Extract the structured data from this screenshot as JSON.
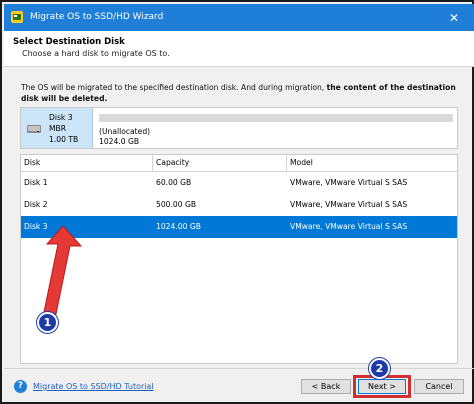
{
  "window": {
    "title": "Migrate OS to SSD/HD Wizard",
    "close_glyph": "✕"
  },
  "header": {
    "title": "Select Destination Disk",
    "subtitle": "Choose a hard disk to migrate OS to."
  },
  "notice": {
    "plain": "The OS will be migrated to the specified destination disk. And during migration, ",
    "bold": "the content of the destination disk will be deleted."
  },
  "summary": {
    "disk_name": "Disk 3",
    "disk_type": "MBR",
    "disk_size": "1.00 TB",
    "partition_label": "(Unallocated)",
    "partition_size": "1024.0 GB"
  },
  "table": {
    "columns": [
      "Disk",
      "Capacity",
      "Model"
    ],
    "rows": [
      {
        "disk": "Disk 1",
        "capacity": "60.00 GB",
        "model": "VMware, VMware Virtual S SAS",
        "selected": false
      },
      {
        "disk": "Disk 2",
        "capacity": "500.00 GB",
        "model": "VMware, VMware Virtual S SAS",
        "selected": false
      },
      {
        "disk": "Disk 3",
        "capacity": "1024.00 GB",
        "model": "VMware, VMware Virtual S SAS",
        "selected": true
      }
    ]
  },
  "footer": {
    "help_glyph": "?",
    "tutorial_link": "Migrate OS to SSD/HD Tutorial",
    "back_label": "< Back",
    "next_label": "Next >",
    "cancel_label": "Cancel"
  },
  "annotations": {
    "step1": "1",
    "step2": "2"
  },
  "colors": {
    "titlebar": "#1f7fd8",
    "selection": "#0078d7",
    "highlight": "#d32f2f",
    "badge": "#1e3aa8",
    "arrow": "#e53935"
  }
}
